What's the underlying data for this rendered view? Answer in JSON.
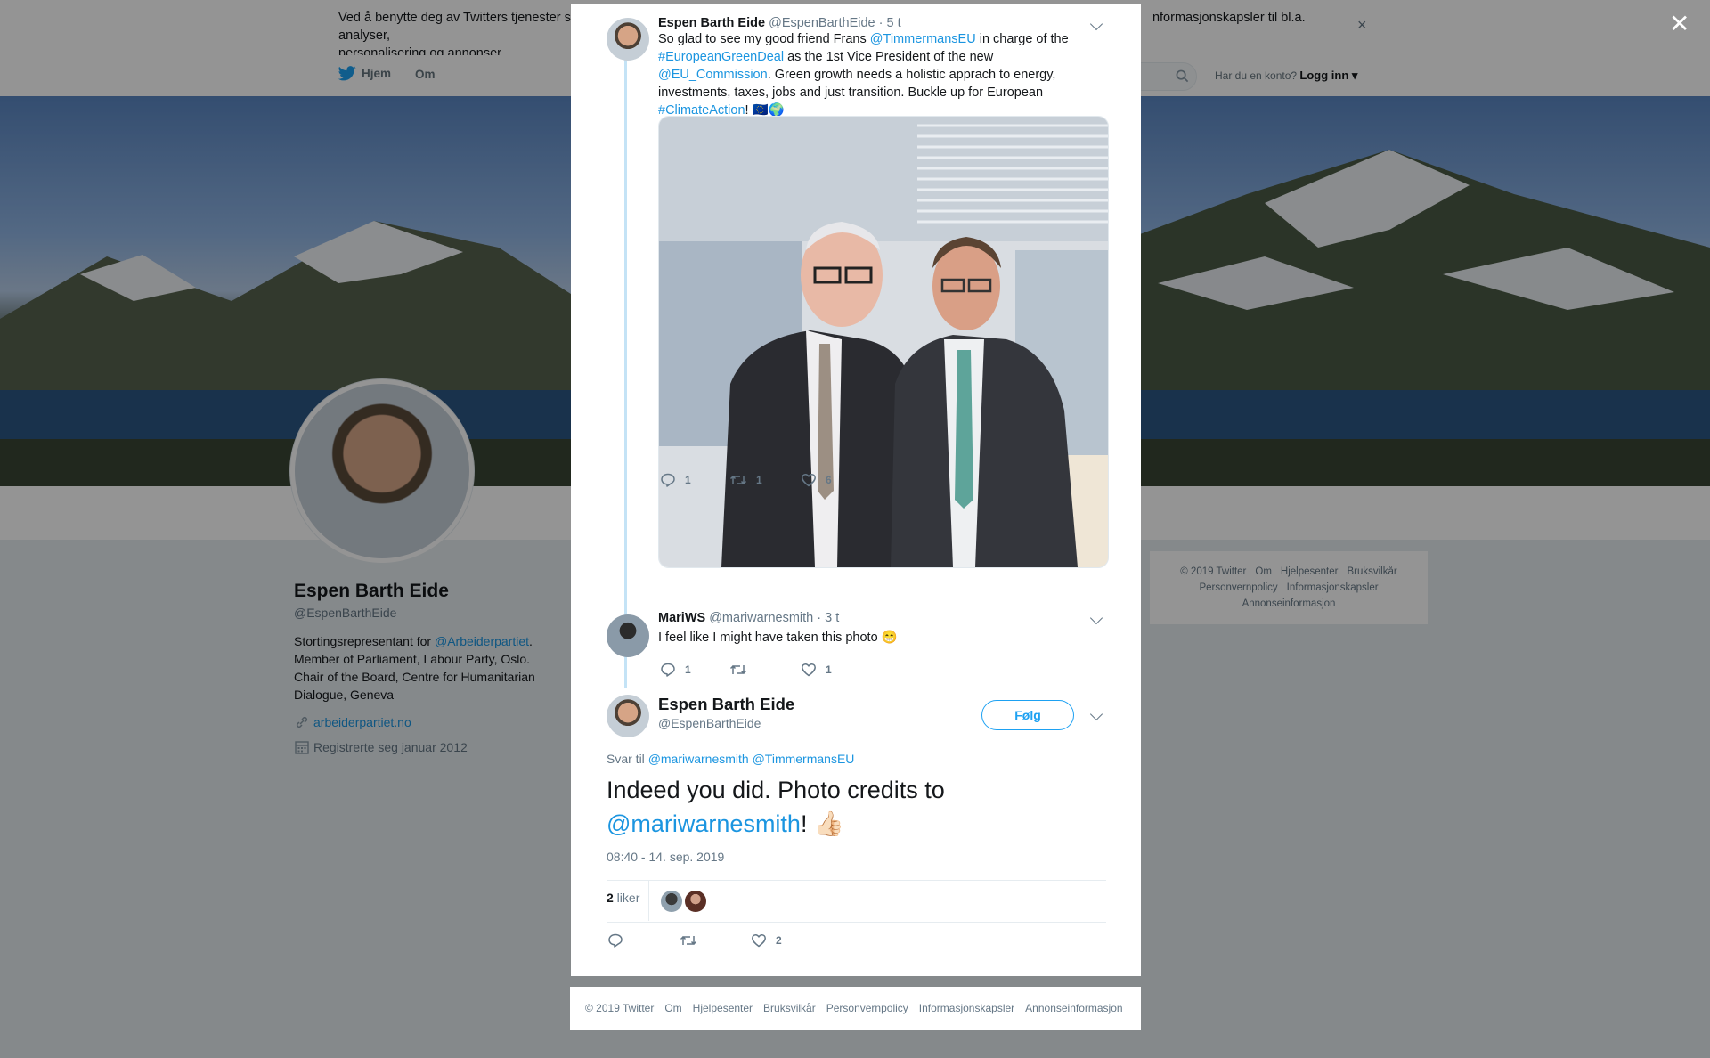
{
  "cookie": {
    "text_left": "Ved å benytte deg av Twitters tjenester sa",
    "text_right": "nformasjonskapsler til bl.a. analyser,",
    "text_line2": "personalisering og annonser."
  },
  "nav": {
    "home": "Hjem",
    "about": "Om",
    "account_prompt": "Har du en konto?",
    "login": "Logg inn"
  },
  "profile": {
    "name": "Espen Barth Eide",
    "handle": "@EspenBarthEide",
    "bio_prefix": "Stortingsrepresentant for ",
    "bio_mention": "@Arbeiderpartiet",
    "bio_rest": ". Member of Parliament, Labour Party, Oslo. Chair of the Board, Centre for Humanitarian Dialogue, Geneva",
    "url": "arbeiderpartiet.no",
    "joined": "Registrerte seg januar 2012"
  },
  "side_footer": {
    "row1": [
      "© 2019 Twitter",
      "Om",
      "Hjelpesenter",
      "Bruksvilkår"
    ],
    "row2": [
      "Personvernpolicy",
      "Informasjonskapsler"
    ],
    "row3": [
      "Annonseinformasjon"
    ]
  },
  "tweet1": {
    "name": "Espen Barth Eide",
    "handle": "@EspenBarthEide",
    "time": "· 5 t",
    "t1": "So glad to see my good friend Frans ",
    "m1": "@TimmermansEU",
    "t2": " in charge of the ",
    "h1": "#EuropeanGreenDeal",
    "t3": " as the 1st Vice President of the new ",
    "m2": "@EU_Commission",
    "t4": ". Green growth needs a holistic apprach to energy, investments, taxes, jobs and just transition. Buckle up for European ",
    "h2": "#ClimateAction",
    "t5": "! 🇪🇺🌍",
    "replies": "1",
    "retweets": "1",
    "likes": "6"
  },
  "tweet2": {
    "name": "MariWS",
    "handle": "@mariwarnesmith",
    "time": "· 3 t",
    "text": "I feel like I might have taken this photo 😁",
    "replies": "1",
    "retweets": "",
    "likes": "1"
  },
  "main_tweet": {
    "name": "Espen Barth Eide",
    "handle": "@EspenBarthEide",
    "follow": "Følg",
    "reply_label": "Svar til ",
    "reply_m1": "@mariwarnesmith",
    "reply_m2": "@TimmermansEU",
    "text1": "Indeed you did. Photo credits to ",
    "text_mention": "@mariwarnesmith",
    "text2": "! 👍🏻",
    "timestamp": "08:40 - 14. sep. 2019",
    "likes_num": "2",
    "likes_word": " liker",
    "like_count": "2"
  },
  "modal_footer": [
    "© 2019 Twitter",
    "Om",
    "Hjelpesenter",
    "Bruksvilkår",
    "Personvernpolicy",
    "Informasjonskapsler",
    "Annonseinformasjon"
  ],
  "icons": {
    "twitter_bird": "bird-icon",
    "close": "close-icon",
    "reply": "reply-icon",
    "retweet": "retweet-icon",
    "like": "heart-icon",
    "link": "link-icon",
    "calendar": "calendar-icon"
  },
  "colors": {
    "link": "#1b95e0",
    "accent": "#1da1f2",
    "thread": "#c4e3f6"
  }
}
